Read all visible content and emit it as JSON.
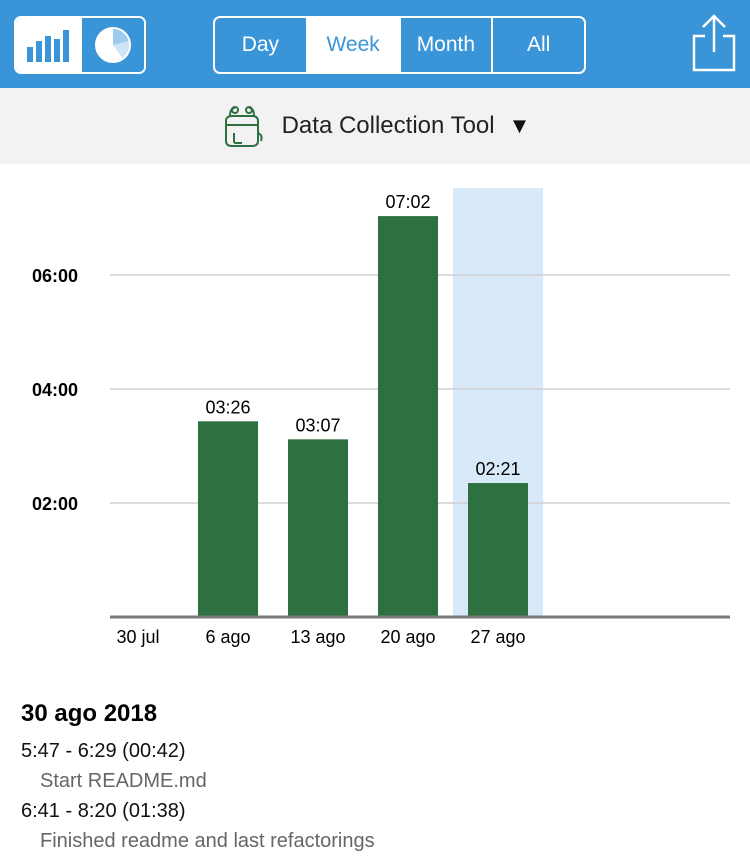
{
  "header": {
    "view_modes": [
      {
        "icon": "bar-chart-icon",
        "active": true
      },
      {
        "icon": "pie-chart-icon",
        "active": false
      }
    ],
    "periods": [
      "Day",
      "Week",
      "Month",
      "All"
    ],
    "active_period": "Week",
    "share_icon": "share-icon",
    "accent_color": "#3a95d8"
  },
  "project": {
    "name": "Data Collection Tool",
    "icon": "backpack-icon",
    "caret": "▼"
  },
  "chart_data": {
    "type": "bar",
    "categories": [
      "30 jul",
      "6 ago",
      "13 ago",
      "20 ago",
      "27 ago"
    ],
    "values": [
      0,
      3.4333,
      3.1167,
      7.0333,
      2.35
    ],
    "labels": [
      "",
      "03:26",
      "03:07",
      "07:02",
      "02:21"
    ],
    "yticks": [
      {
        "value": 2,
        "label": "02:00"
      },
      {
        "value": 4,
        "label": "04:00"
      },
      {
        "value": 6,
        "label": "06:00"
      }
    ],
    "ylim": [
      0,
      7.55
    ],
    "highlighted_category": "27 ago",
    "bar_color": "#2e7040",
    "highlight_color": "#d8eaf9",
    "grid": true
  },
  "details": {
    "date": "30 ago 2018",
    "entries": [
      {
        "range": "5:47 - 6:29 (00:42)",
        "note": "Start README.md"
      },
      {
        "range": "6:41 - 8:20 (01:38)",
        "note": "Finished readme and last refactorings"
      }
    ]
  }
}
